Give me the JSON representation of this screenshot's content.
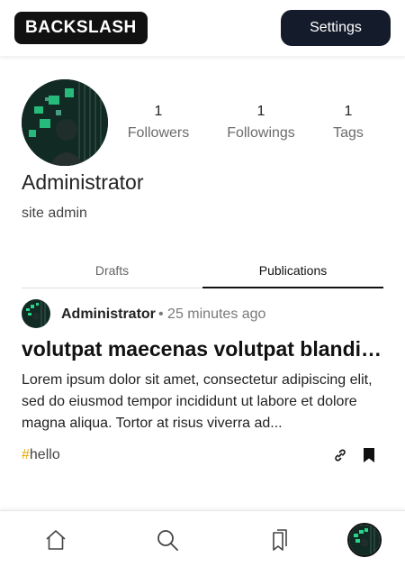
{
  "header": {
    "logo": "BACKSLASH",
    "settings_label": "Settings"
  },
  "profile": {
    "name": "Administrator",
    "bio": "site admin",
    "stats": {
      "followers_count": "1",
      "followers_label": "Followers",
      "followings_count": "1",
      "followings_label": "Followings",
      "tags_count": "1",
      "tags_label": "Tags"
    }
  },
  "tabs": {
    "drafts": "Drafts",
    "publications": "Publications",
    "active": "Publications"
  },
  "post": {
    "author": "Administrator",
    "time": "• 25 minutes ago",
    "title": "volutpat maecenas volutpat blandit aliquam",
    "body": "Lorem ipsum dolor sit amet, consectetur adipiscing elit, sed do eiusmod tempor incididunt ut labore et dolore magna aliqua. Tortor at risus viverra ad...",
    "tag_hash": "#",
    "tag": "hello"
  },
  "icons": {
    "link": "link-icon",
    "bookmark": "bookmark-icon",
    "home": "home-icon",
    "search": "search-icon",
    "bookmarks": "bookmarks-icon"
  },
  "colors": {
    "settings_bg": "#141c2b",
    "tag_hash": "#e0a800",
    "avatar_green": "#39d98a"
  }
}
